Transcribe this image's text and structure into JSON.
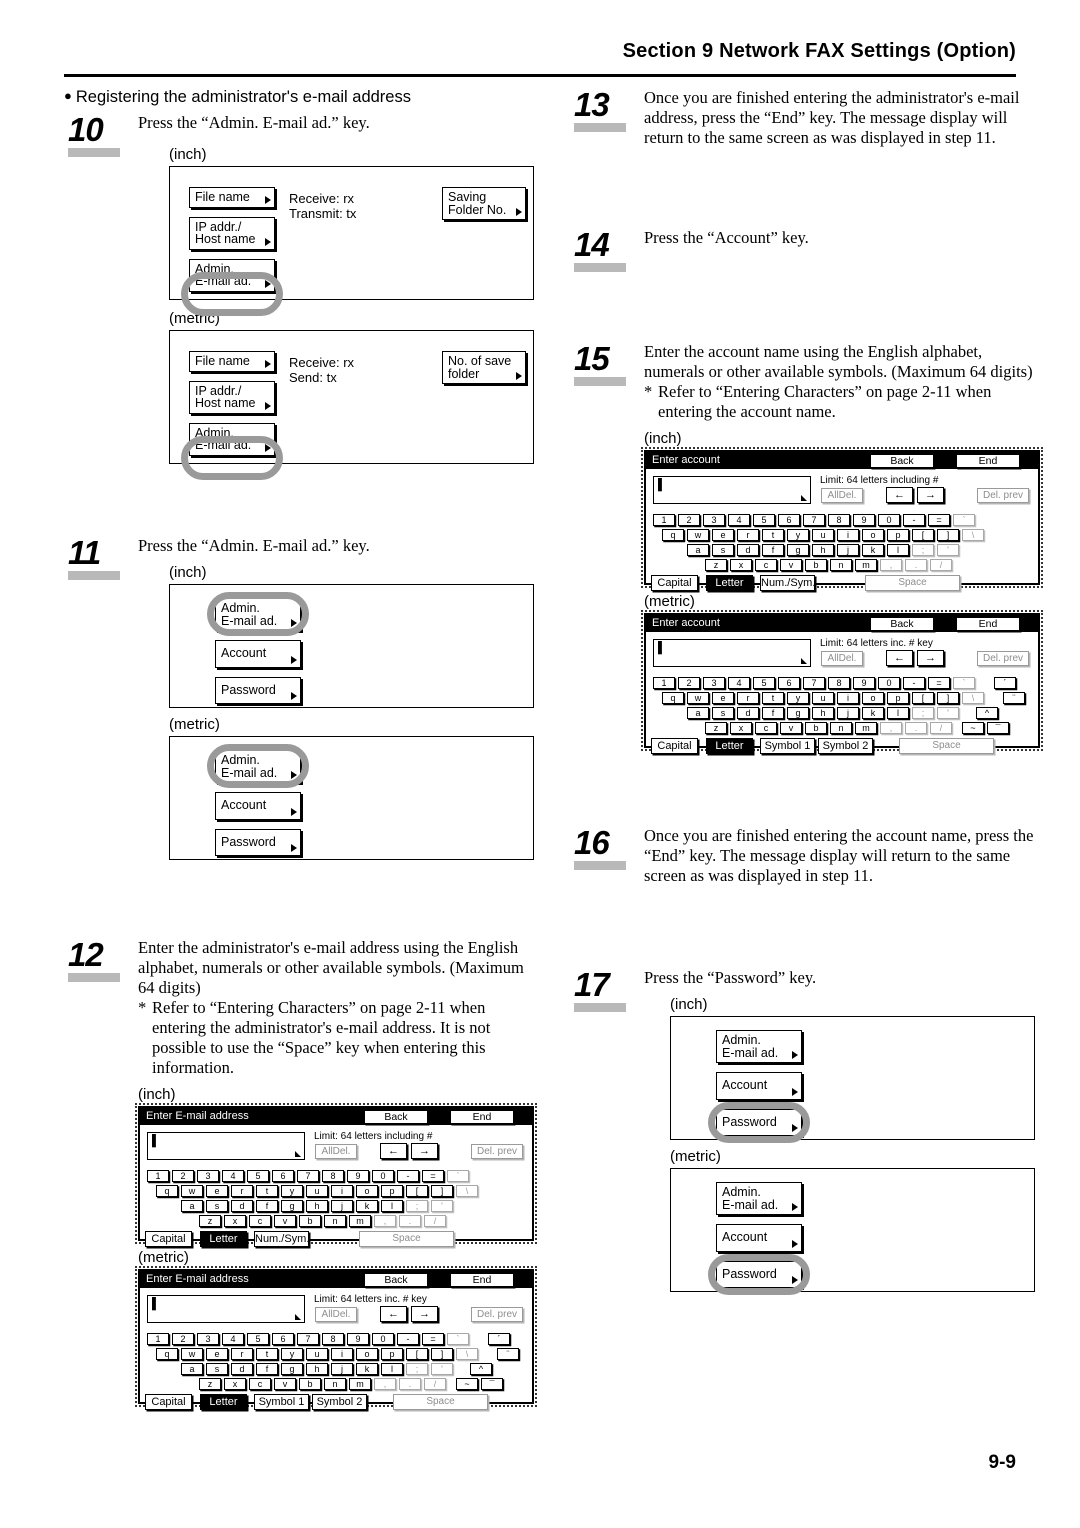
{
  "header": {
    "title": "Section 9  Network FAX Settings (Option)"
  },
  "footer": {
    "page": "9-9"
  },
  "labels": {
    "inch": "(inch)",
    "metric": "(metric)"
  },
  "section": {
    "bullet": "Registering the administrator's e-mail address"
  },
  "steps": {
    "s10": {
      "num": "10",
      "text": "Press the “Admin. E-mail ad.” key.",
      "inch_screen": {
        "keys": [
          {
            "label": "File name"
          },
          {
            "label": "IP addr./\nHost name"
          },
          {
            "label": "Admin.\nE-mail ad.",
            "highlighted": true
          }
        ],
        "static_text": "Receive: rx\nTransmit: tx",
        "right_key": "Saving\nFolder No."
      },
      "metric_screen": {
        "keys": [
          {
            "label": "File name"
          },
          {
            "label": "IP addr./\nHost name"
          },
          {
            "label": "Admin.\nE-mail ad.",
            "highlighted": true
          }
        ],
        "static_text": "Receive: rx\nSend: tx",
        "right_key": "No. of save\nfolder"
      }
    },
    "s11": {
      "num": "11",
      "text": "Press the “Admin. E-mail ad.” key.",
      "keys": [
        {
          "label": "Admin.\nE-mail ad.",
          "highlighted": true
        },
        {
          "label": "Account",
          "highlighted": false
        },
        {
          "label": "Password",
          "highlighted": false
        }
      ]
    },
    "s12": {
      "num": "12",
      "text": "Enter the administrator's e-mail address using the English alphabet, numerals or other available symbols. (Maximum 64 digits)",
      "note_marker": "*",
      "note": "Refer to “Entering Characters” on page 2-11 when entering the administrator's e-mail address. It is not possible to use the “Space” key when entering this information.",
      "keyboard_title": "Enter E-mail address"
    },
    "s13": {
      "num": "13",
      "text": "Once you are finished entering the administrator's e-mail address, press the “End” key. The message display will return to the same screen as was displayed in step 11."
    },
    "s14": {
      "num": "14",
      "text": "Press the “Account” key."
    },
    "s15": {
      "num": "15",
      "text": "Enter the account name using the English alphabet, numerals or other available symbols. (Maximum 64 digits)",
      "note_marker": "*",
      "note": "Refer to “Entering Characters” on page 2-11 when entering the account name.",
      "keyboard_title": "Enter account"
    },
    "s16": {
      "num": "16",
      "text": "Once you are finished entering the account name, press the “End” key. The message display will return to the same screen as was displayed in step 11."
    },
    "s17": {
      "num": "17",
      "text": "Press the “Password” key.",
      "keys": [
        {
          "label": "Admin.\nE-mail ad.",
          "highlighted": false
        },
        {
          "label": "Account",
          "highlighted": false
        },
        {
          "label": "Password",
          "highlighted": true
        }
      ]
    }
  },
  "keyboard": {
    "back_label": "Back",
    "end_label": "End",
    "input_value": "",
    "caret": "▌",
    "limit_inch": "Limit: 64 letters including #",
    "limit_metric": "Limit: 64 letters inc. # key",
    "alldel_label": "AllDel.",
    "left_arrow": "←",
    "right_arrow": "→",
    "delprev_label": "Del. prev",
    "capital_label": "Capital",
    "letter_label": "Letter",
    "numsym_label": "Num./Sym.",
    "symbol1_label": "Symbol 1",
    "symbol2_label": "Symbol 2",
    "space_label": "Space",
    "rows": {
      "row1": [
        "1",
        "2",
        "3",
        "4",
        "5",
        "6",
        "7",
        "8",
        "9",
        "0",
        "-",
        "=",
        "`"
      ],
      "row2": [
        "q",
        "w",
        "e",
        "r",
        "t",
        "y",
        "u",
        "i",
        "o",
        "p",
        "[",
        "]",
        "\\"
      ],
      "row3": [
        "a",
        "s",
        "d",
        "f",
        "g",
        "h",
        "j",
        "k",
        "l",
        ";",
        "'"
      ],
      "row4": [
        "z",
        "x",
        "c",
        "v",
        "b",
        "n",
        "m",
        ",",
        ".",
        "/"
      ]
    },
    "metric_extra": {
      "row1": [
        "´"
      ],
      "row2": [
        "¨"
      ],
      "row3": [
        "^"
      ],
      "row4": [
        "~",
        "¯"
      ]
    }
  }
}
